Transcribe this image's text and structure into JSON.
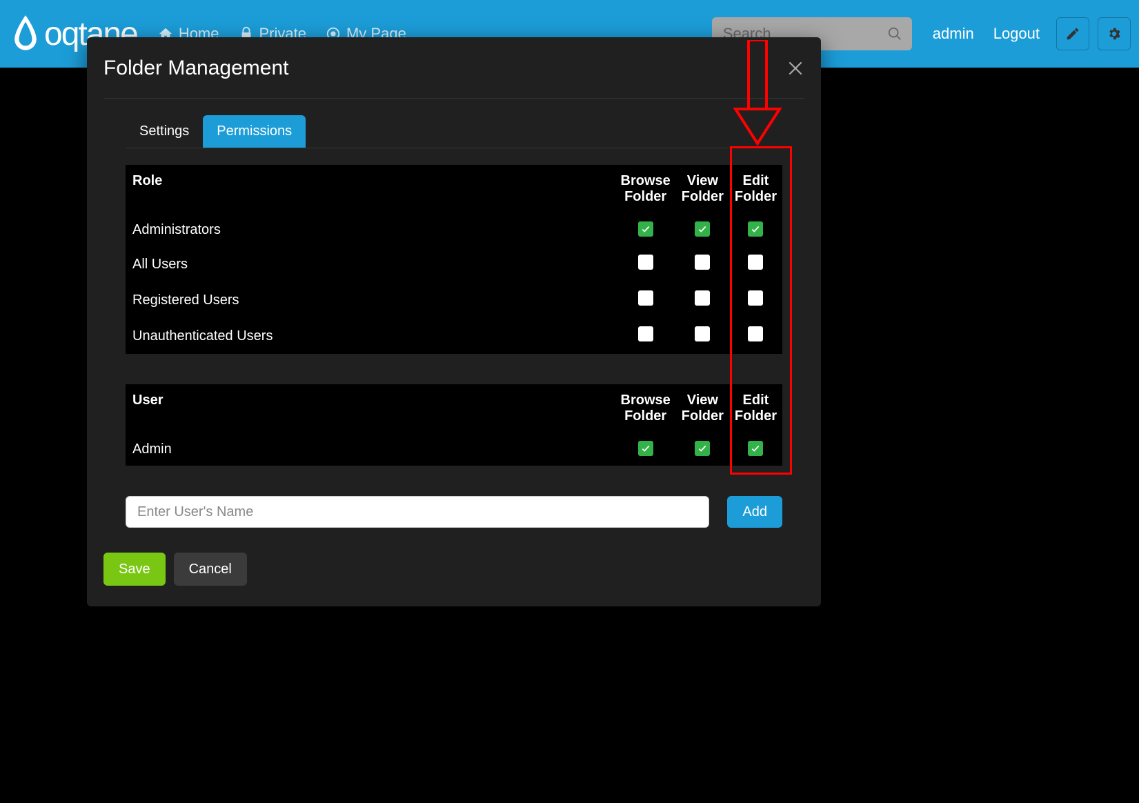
{
  "header": {
    "logo_text": "oqtane",
    "nav": [
      {
        "icon": "home",
        "label": "Home"
      },
      {
        "icon": "lock",
        "label": "Private"
      },
      {
        "icon": "target",
        "label": "My Page"
      }
    ],
    "search_placeholder": "Search",
    "user_links": {
      "username": "admin",
      "logout": "Logout"
    }
  },
  "modal": {
    "title": "Folder Management",
    "tabs": {
      "settings": "Settings",
      "permissions": "Permissions"
    },
    "columns": {
      "role": "Role",
      "user": "User",
      "browse": "Browse Folder",
      "view": "View Folder",
      "edit": "Edit Folder"
    },
    "roles": [
      {
        "name": "Administrators",
        "browse": true,
        "view": true,
        "edit": true
      },
      {
        "name": "All Users",
        "browse": false,
        "view": false,
        "edit": false
      },
      {
        "name": "Registered Users",
        "browse": false,
        "view": false,
        "edit": false
      },
      {
        "name": "Unauthenticated Users",
        "browse": false,
        "view": false,
        "edit": false
      }
    ],
    "users": [
      {
        "name": "Admin",
        "browse": true,
        "view": true,
        "edit": true
      }
    ],
    "user_input_placeholder": "Enter User's Name",
    "buttons": {
      "add": "Add",
      "save": "Save",
      "cancel": "Cancel"
    }
  }
}
